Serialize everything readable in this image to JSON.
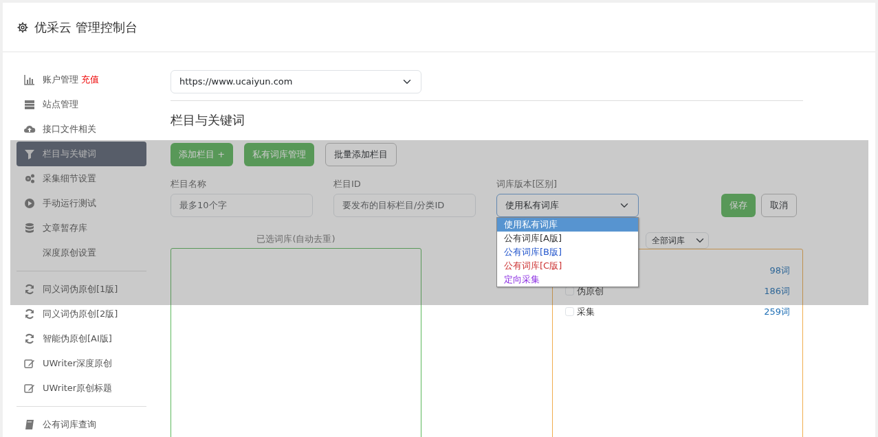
{
  "header": {
    "title": "优采云 管理控制台"
  },
  "sidebar": {
    "groups": [
      {
        "items": [
          {
            "kind": "chart",
            "label": "账户管理",
            "extra": "充值",
            "selected": false
          },
          {
            "kind": "server",
            "label": "站点管理",
            "selected": false
          },
          {
            "kind": "cloud",
            "label": "接口文件相关",
            "selected": false
          },
          {
            "kind": "filter",
            "label": "栏目与关键词",
            "selected": true
          },
          {
            "kind": "gears",
            "label": "采集细节设置",
            "selected": false
          },
          {
            "kind": "play",
            "label": "手动运行测试",
            "selected": false
          },
          {
            "kind": "db",
            "label": "文章暂存库",
            "selected": false
          },
          {
            "kind": "plain",
            "label": "深度原创设置",
            "selected": false
          }
        ]
      },
      {
        "items": [
          {
            "kind": "refresh",
            "label": "同义词伪原创[1版]",
            "selected": false
          },
          {
            "kind": "refresh",
            "label": "同义词伪原创[2版]",
            "selected": false
          },
          {
            "kind": "refresh",
            "label": "智能伪原创[AI版]",
            "selected": false
          },
          {
            "kind": "edit",
            "label": "UWriter深度原创",
            "selected": false
          },
          {
            "kind": "edit",
            "label": "UWriter原创标题",
            "selected": false
          }
        ]
      },
      {
        "items": [
          {
            "kind": "book",
            "label": "公有词库查询",
            "selected": false
          }
        ]
      }
    ]
  },
  "site_select": {
    "value": "https://www.ucaiyun.com"
  },
  "section_title": "栏目与关键词",
  "toolbar": [
    {
      "label": "添加栏目 +",
      "kind": "primary"
    },
    {
      "label": "私有词库管理",
      "kind": "primary"
    },
    {
      "label": "批量添加栏目",
      "kind": "outline"
    }
  ],
  "form": {
    "fields": [
      {
        "label": "栏目名称",
        "placeholder": "最多10个字"
      },
      {
        "label": "栏目ID",
        "placeholder": "要发布的目标栏目/分类ID"
      }
    ],
    "library": {
      "label": "词库版本[区别]",
      "value": "使用私有词库",
      "options": [
        {
          "label": "使用私有词库",
          "selected": true
        },
        {
          "label": "公有词库[A版]",
          "selected": false
        },
        {
          "label": "公有词库[B版]",
          "selected": false,
          "color": "#2255cc"
        },
        {
          "label": "公有词库[C版]",
          "selected": false,
          "color": "#cc3333"
        },
        {
          "label": "定向采集",
          "selected": false,
          "color": "#8a2be2"
        }
      ]
    },
    "save": "保存",
    "cancel": "取消"
  },
  "selected_panel": {
    "title": "已选词库(自动去重)"
  },
  "library_panel": {
    "filter": "全部词库",
    "items": [
      {
        "count": "98词"
      },
      {
        "label": "伪原创",
        "count": "186词",
        "checked": false
      },
      {
        "label": "采集",
        "count": "259词",
        "checked": false
      }
    ]
  }
}
